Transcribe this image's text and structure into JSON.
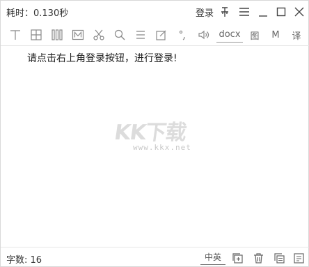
{
  "titlebar": {
    "elapsed": "耗时：0.130秒",
    "login_label": "登录"
  },
  "toolbar": {
    "docx_label": "docx",
    "image_label": "图",
    "m_label": "M",
    "translate_label": "译"
  },
  "content": {
    "message": "请点击右上角登录按钮，进行登录!"
  },
  "watermark": {
    "logo_text": "KK下载",
    "url": "www.kkx.net"
  },
  "statusbar": {
    "word_count": "字数:  16",
    "language_label": "中英"
  },
  "colors": {
    "icon": "#888888",
    "text": "#222222",
    "divider": "#e6e6e6"
  }
}
